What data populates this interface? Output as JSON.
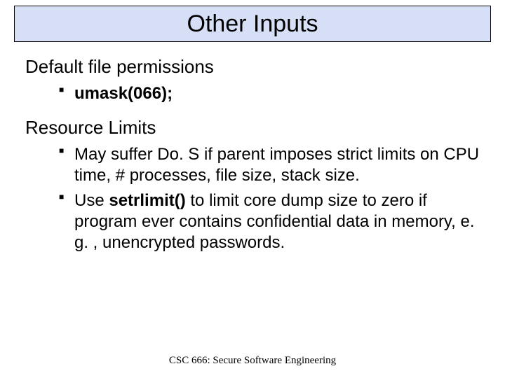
{
  "title": "Other Inputs",
  "sections": [
    {
      "heading": "Default file permissions",
      "bullets": [
        {
          "text": "umask(066);",
          "bold": true
        }
      ]
    },
    {
      "heading": "Resource Limits",
      "bullets": [
        {
          "text": "May suffer Do. S if parent imposes strict limits on CPU time, # processes, file size, stack size.",
          "bold": false
        },
        {
          "prefix": "Use ",
          "bold_part": "setrlimit()",
          "suffix": " to limit core dump size to zero if program ever contains confidential data in memory, e. g. , unencrypted passwords."
        }
      ]
    }
  ],
  "footer": "CSC 666: Secure Software Engineering"
}
